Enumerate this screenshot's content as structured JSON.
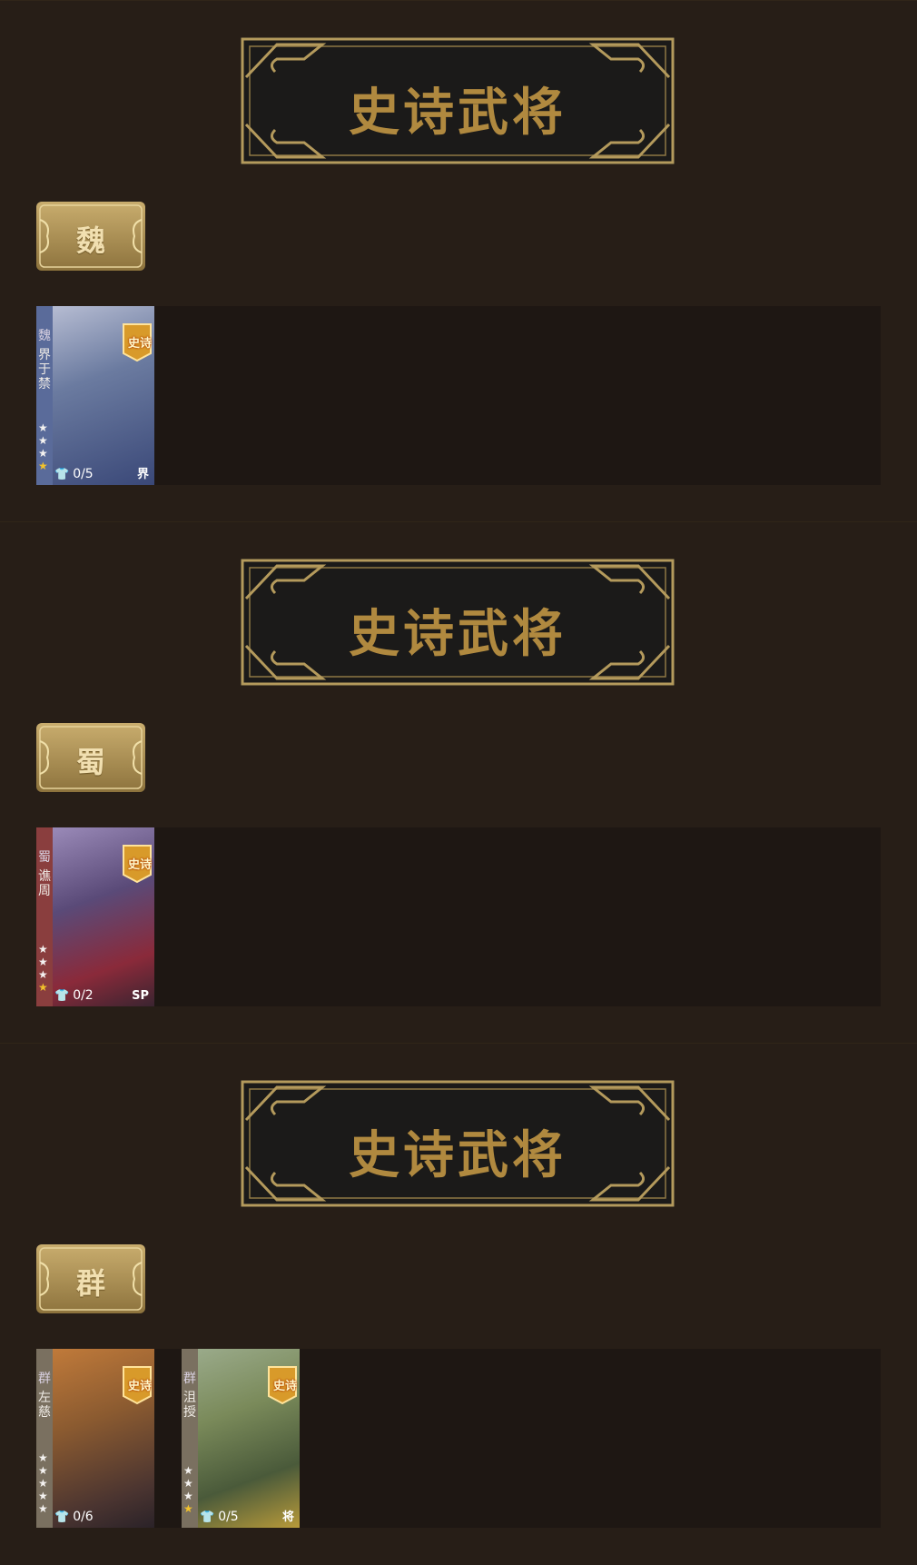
{
  "sections": [
    {
      "banner": "史诗武将",
      "faction": "魏",
      "cards": [
        {
          "faction_char": "魏",
          "name": "界于禁",
          "stars": 1,
          "skins": "0/5",
          "tag": "界",
          "badge": "史诗",
          "stripe": "#5a6b9a",
          "portrait": "#6b7ba0"
        }
      ]
    },
    {
      "banner": "史诗武将",
      "faction": "蜀",
      "cards": [
        {
          "faction_char": "蜀",
          "name": "谯周",
          "stars": 1,
          "skins": "0/2",
          "tag": "SP",
          "badge": "史诗",
          "stripe": "#8a3e3e",
          "portrait": "#5a4a78"
        }
      ]
    },
    {
      "banner": "史诗武将",
      "faction": "群",
      "cards": [
        {
          "faction_char": "群",
          "name": "左慈",
          "stars": 0,
          "skins": "0/6",
          "tag": "",
          "badge": "史诗",
          "stripe": "#7a7060",
          "portrait": "#8a5a30"
        },
        {
          "faction_char": "群",
          "name": "沮授",
          "stars": 1,
          "skins": "0/5",
          "tag": "将",
          "badge": "史诗",
          "stripe": "#7a7060",
          "portrait": "#7a8a5a"
        }
      ]
    }
  ],
  "icons": {
    "skin": "shirt-icon",
    "star": "star-icon",
    "badge": "epic-badge-icon"
  },
  "colors": {
    "gold": "#b0893f",
    "background": "#271e17",
    "row_bg": "#1e1713"
  }
}
